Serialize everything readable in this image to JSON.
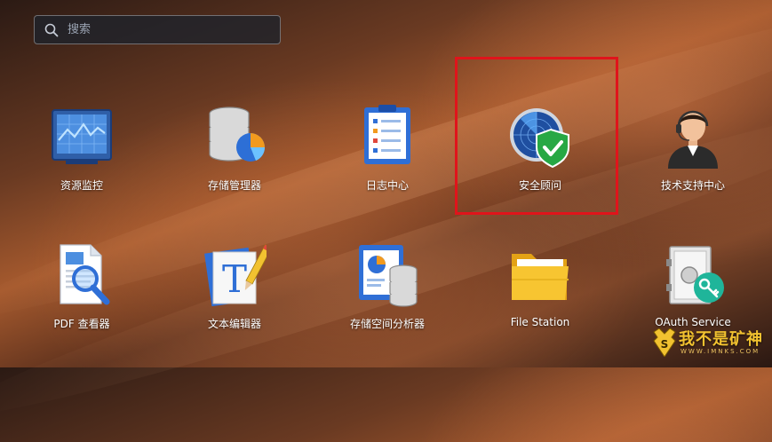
{
  "search": {
    "placeholder": "搜索"
  },
  "apps": [
    {
      "label": "资源监控",
      "icon": "resource-monitor-icon"
    },
    {
      "label": "存储管理器",
      "icon": "storage-manager-icon"
    },
    {
      "label": "日志中心",
      "icon": "log-center-icon"
    },
    {
      "label": "安全顾问",
      "icon": "security-advisor-icon"
    },
    {
      "label": "技术支持中心",
      "icon": "support-center-icon"
    },
    {
      "label": "PDF 查看器",
      "icon": "pdf-viewer-icon"
    },
    {
      "label": "文本编辑器",
      "icon": "text-editor-icon"
    },
    {
      "label": "存储空间分析器",
      "icon": "storage-analyzer-icon"
    },
    {
      "label": "File Station",
      "icon": "file-station-icon"
    },
    {
      "label": "OAuth Service",
      "icon": "oauth-service-icon"
    }
  ],
  "watermark": {
    "text": "我不是矿神",
    "sub": "WWW.IMNKS.COM"
  },
  "colors": {
    "highlight": "#e0141b",
    "accent": "#f2c230"
  }
}
